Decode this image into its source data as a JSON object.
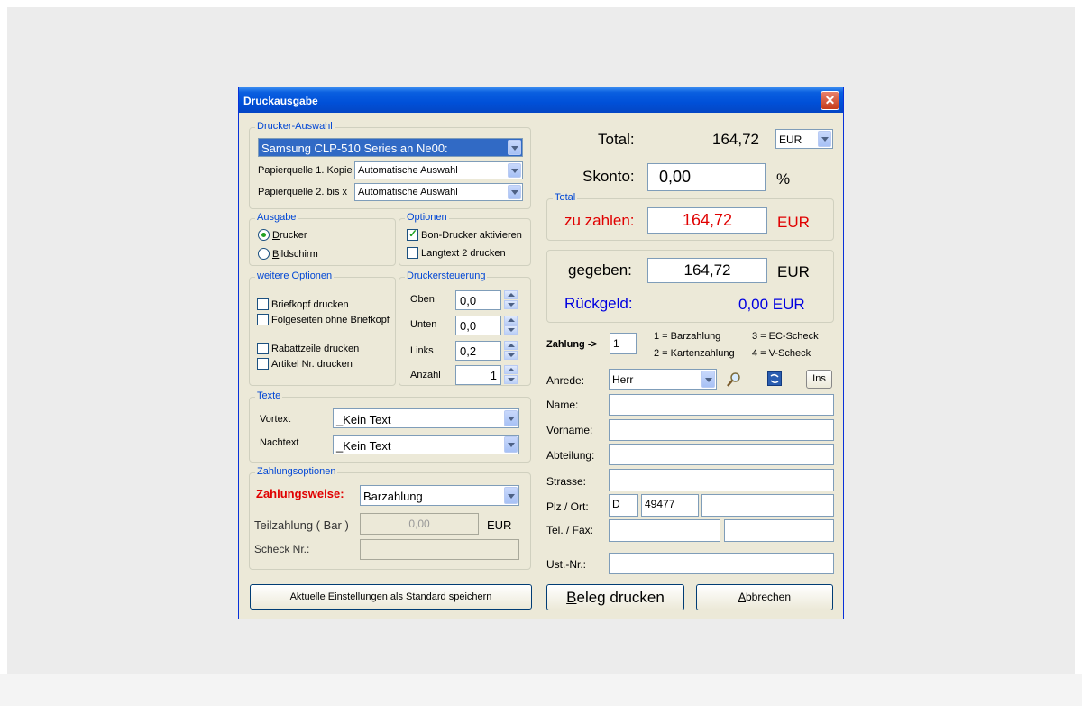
{
  "window": {
    "title": "Druckausgabe",
    "close_symbol": "✕"
  },
  "printer_selection": {
    "legend": "Drucker-Auswahl",
    "printer": "Samsung CLP-510 Series an Ne00:",
    "paper_source_1_label": "Papierquelle 1. Kopie",
    "paper_source_1_value": "Automatische Auswahl",
    "paper_source_2_label": "Papierquelle 2. bis x",
    "paper_source_2_value": "Automatische Auswahl"
  },
  "output": {
    "legend": "Ausgabe",
    "printer_first": "D",
    "printer_rest": "rucker",
    "screen_first": "B",
    "screen_rest": "ildschirm",
    "selected": "printer"
  },
  "options": {
    "legend": "Optionen",
    "receipt_printer_label": "Bon-Drucker aktivieren",
    "receipt_printer_checked": true,
    "longtext_label": "Langtext 2 drucken",
    "longtext_checked": false
  },
  "more_options": {
    "legend": "weitere Optionen",
    "items": [
      {
        "label": "Briefkopf drucken",
        "checked": false
      },
      {
        "label": "Folgeseiten ohne Briefkopf",
        "checked": false
      },
      {
        "label": "Rabattzeile drucken",
        "checked": false
      },
      {
        "label": "Artikel Nr. drucken",
        "checked": false
      }
    ]
  },
  "printer_control": {
    "legend": "Druckersteuerung",
    "top_label": "Oben",
    "top_value": "0,0",
    "bottom_label": "Unten",
    "bottom_value": "0,0",
    "left_label": "Links",
    "left_value": "0,2",
    "count_label": "Anzahl",
    "count_value": "1"
  },
  "texts": {
    "legend": "Texte",
    "pre_label": "Vortext",
    "pre_value": "_Kein Text",
    "post_label": "Nachtext",
    "post_value": "_Kein Text"
  },
  "payment_options": {
    "legend": "Zahlungsoptionen",
    "method_label": "Zahlungsweise:",
    "method_value": "Barzahlung",
    "partial_label": "Teilzahlung ( Bar )",
    "partial_value": "0,00",
    "partial_currency": "EUR",
    "cheque_label": "Scheck Nr.:",
    "cheque_value": ""
  },
  "save_default_button": "Aktuelle Einstellungen als Standard speichern",
  "totals": {
    "total_label": "Total:",
    "total_value": "164,72",
    "currency": "EUR",
    "discount_label": "Skonto:",
    "discount_value": "0,00",
    "discount_unit": "%",
    "group_legend": "Total",
    "to_pay_label": "zu zahlen:",
    "to_pay_value": "164,72",
    "to_pay_currency": "EUR",
    "given_label": "gegeben:",
    "given_value": "164,72",
    "given_currency": "EUR",
    "change_label": "Rückgeld:",
    "change_value": "0,00 EUR"
  },
  "payment": {
    "label": "Zahlung ->",
    "value": "1",
    "legend_1": "1 = Barzahlung",
    "legend_2": "2 = Kartenzahlung",
    "legend_3": "3 = EC-Scheck",
    "legend_4": "4 = V-Scheck"
  },
  "address": {
    "salutation_label": "Anrede:",
    "salutation_value": "Herr",
    "ins_button": "Ins",
    "name_label": "Name:",
    "name_value": "",
    "firstname_label": "Vorname:",
    "firstname_value": "",
    "department_label": "Abteilung:",
    "department_value": "",
    "street_label": "Strasse:",
    "street_value": "",
    "zip_label": "Plz / Ort:",
    "country_value": "D",
    "zip_value": "49477",
    "city_value": "",
    "phone_label": "Tel. / Fax:",
    "phone_value": "",
    "fax_value": "",
    "vat_label": "Ust.-Nr.:",
    "vat_value": ""
  },
  "buttons": {
    "print_first": "B",
    "print_rest": "eleg drucken",
    "cancel_first": "A",
    "cancel_rest": "bbrechen"
  },
  "colors": {
    "red": "#e00000",
    "blue": "#0000e0",
    "legend_blue": "#0046d5",
    "title_blue": "#0050d8"
  }
}
